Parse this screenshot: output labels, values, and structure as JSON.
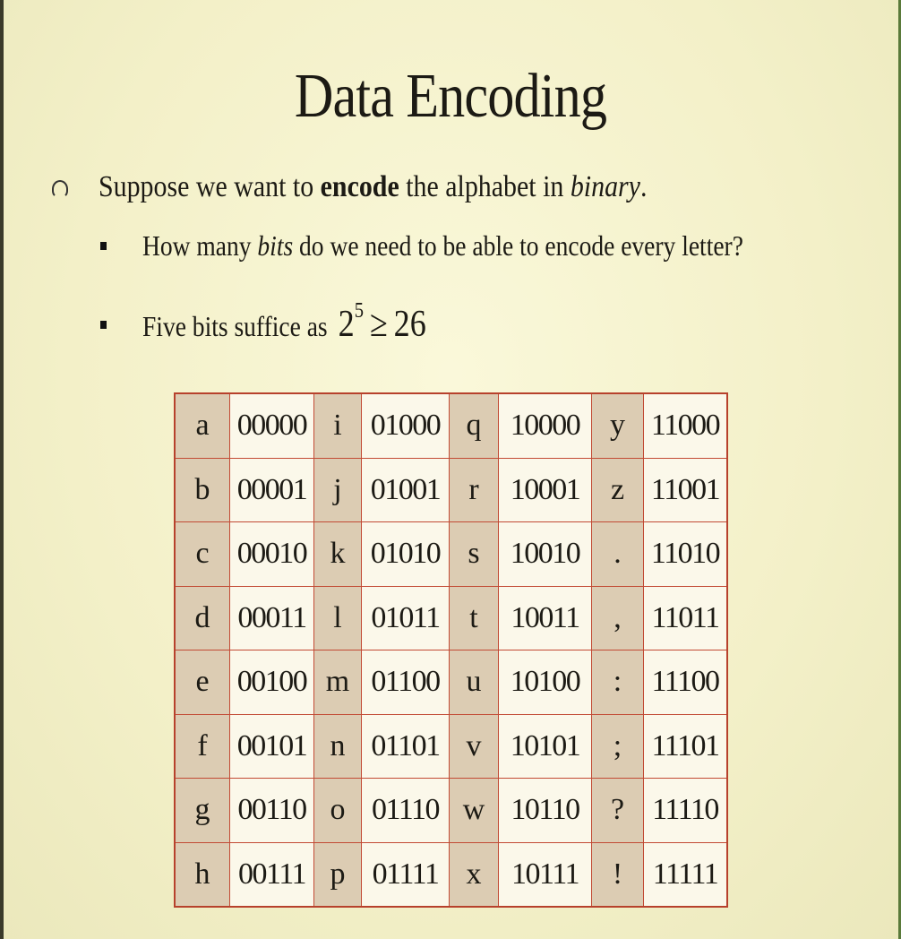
{
  "slide": {
    "title": "Data Encoding",
    "bullet1": {
      "pre": "Suppose we want to ",
      "bold": "encode",
      "mid": " the alphabet in ",
      "italic": "binary",
      "post": "."
    },
    "bullet2": {
      "pre": "How many ",
      "italic": "bits",
      "post": " do we need to be able to encode every letter?"
    },
    "bullet3": {
      "text": "Five bits suffice as ",
      "base": "2",
      "exp": "5",
      "op": "≥",
      "rhs": "26"
    }
  },
  "table": {
    "rows": [
      [
        "a",
        "00000",
        "i",
        "01000",
        "q",
        "10000",
        "y",
        "11000"
      ],
      [
        "b",
        "00001",
        "j",
        "01001",
        "r",
        "10001",
        "z",
        "11001"
      ],
      [
        "c",
        "00010",
        "k",
        "01010",
        "s",
        "10010",
        ".",
        "11010"
      ],
      [
        "d",
        "00011",
        "l",
        "01011",
        "t",
        "10011",
        ",",
        "11011"
      ],
      [
        "e",
        "00100",
        "m",
        "01100",
        "u",
        "10100",
        ":",
        "11100"
      ],
      [
        "f",
        "00101",
        "n",
        "01101",
        "v",
        "10101",
        ";",
        "11101"
      ],
      [
        "g",
        "00110",
        "o",
        "01110",
        "w",
        "10110",
        "?",
        "11110"
      ],
      [
        "h",
        "00111",
        "p",
        "01111",
        "x",
        "10111",
        "!",
        "11111"
      ]
    ]
  }
}
